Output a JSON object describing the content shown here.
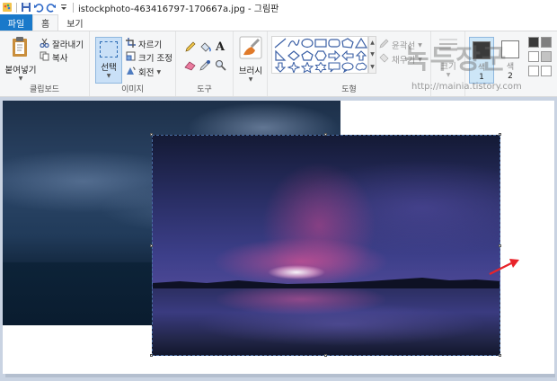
{
  "window": {
    "title": "istockphoto-463416797-170667a.jpg - 그림판"
  },
  "tabs": [
    {
      "label": "파일"
    },
    {
      "label": "홈"
    },
    {
      "label": "보기"
    }
  ],
  "ribbon": {
    "clipboard": {
      "paste_label": "붙여넣기",
      "cut_label": "잘라내기",
      "copy_label": "복사",
      "group_label": "클립보드"
    },
    "image": {
      "select_label": "선택",
      "crop_label": "자르기",
      "resize_label": "크기 조정",
      "rotate_label": "회전",
      "group_label": "이미지"
    },
    "tools": {
      "group_label": "도구"
    },
    "brush": {
      "label": "브러시"
    },
    "shapes": {
      "outline_label": "윤곽선",
      "fill_label": "채우기",
      "group_label": "도형"
    },
    "size": {
      "label": "크기"
    },
    "colors": {
      "color1_label": "색",
      "color1_num": "1",
      "color2_label": "색",
      "color2_num": "2",
      "color1_value": "#3a3a3a",
      "color2_value": "#ffffff"
    }
  },
  "watermark": {
    "main": "녹두장군",
    "sub": "http://mainia.tistory.com"
  },
  "colors": {
    "accent": "#1979ca",
    "arrow": "#e8232a"
  }
}
